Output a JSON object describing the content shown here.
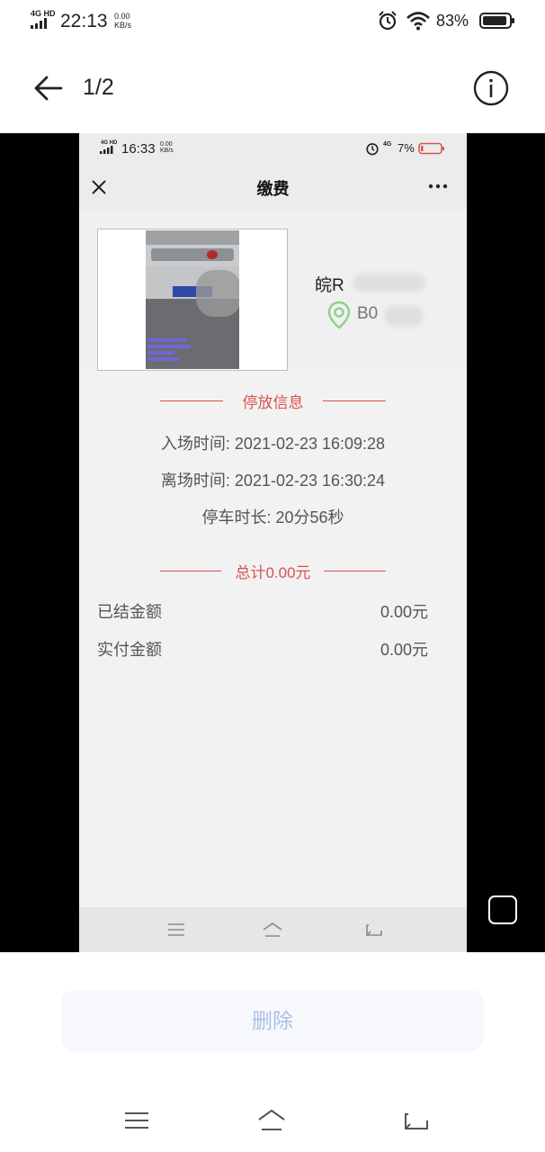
{
  "status_bar": {
    "network": "4G HD",
    "time": "22:13",
    "speed_value": "0.00",
    "speed_unit": "KB/s",
    "battery": "83%"
  },
  "top_bar": {
    "page_indicator": "1/2"
  },
  "inner": {
    "status_bar": {
      "network": "4G HD",
      "time": "16:33",
      "speed_value": "0.00",
      "speed_unit": "KB/s",
      "network2": "4G",
      "battery": "7%"
    },
    "header": {
      "title": "缴费"
    },
    "vehicle": {
      "plate": "皖R",
      "spot": "B0"
    },
    "parking_info": {
      "section_title": "停放信息",
      "entry_time": "入场时间: 2021-02-23 16:09:28",
      "exit_time": "离场时间: 2021-02-23 16:30:24",
      "duration": "停车时长: 20分56秒"
    },
    "total": {
      "section_title": "总计0.00元"
    },
    "amounts": {
      "settled_label": "已结金额",
      "settled_value": "0.00元",
      "paid_label": "实付金额",
      "paid_value": "0.00元"
    }
  },
  "actions": {
    "delete_label": "删除"
  },
  "colors": {
    "accent_red": "#d9534f",
    "delete_text": "#a9bfe7",
    "location_green": "#8fd08a"
  }
}
